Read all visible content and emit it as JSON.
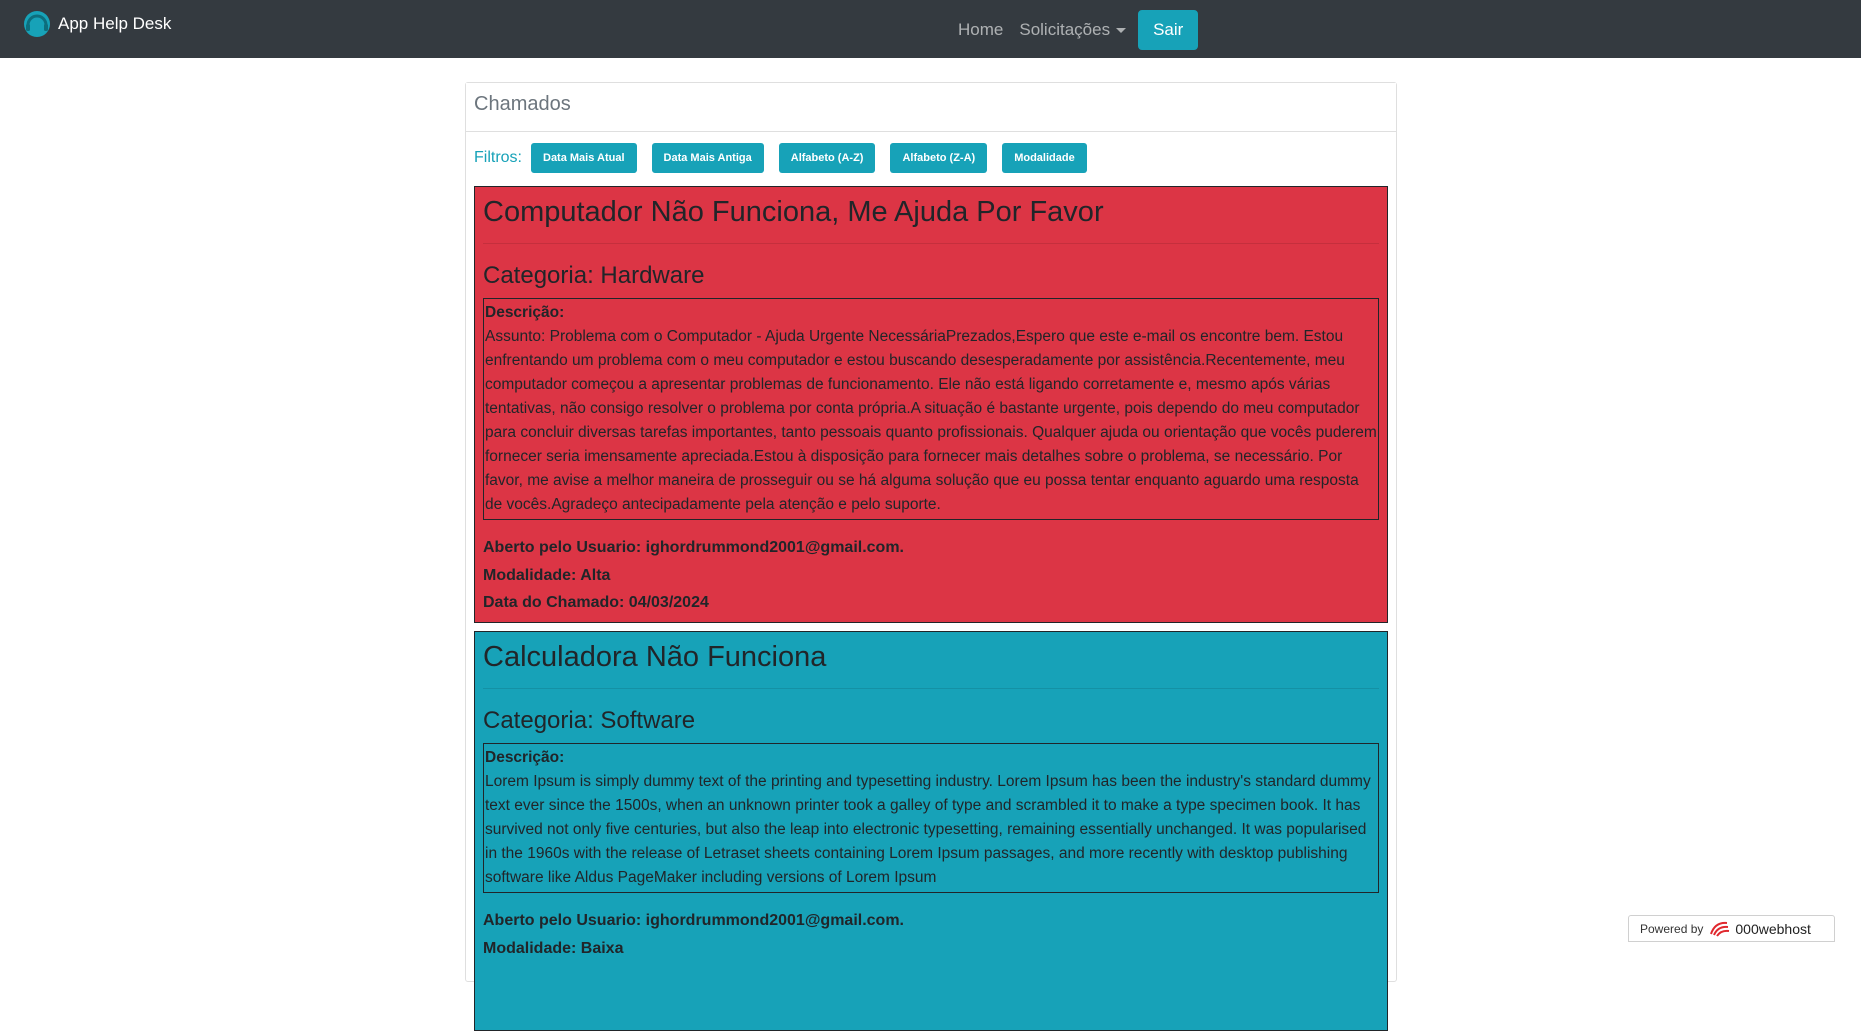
{
  "navbar": {
    "brand": "App Help Desk",
    "home": "Home",
    "solicitacoes": "Solicitações",
    "sair": "Sair"
  },
  "card": {
    "header": "Chamados",
    "filters_label": "Filtros:",
    "filters": [
      "Data Mais Atual",
      "Data Mais Antiga",
      "Alfabeto (A-Z)",
      "Alfabeto (Z-A)",
      "Modalidade"
    ]
  },
  "tickets": [
    {
      "title": "Computador Não Funciona, Me Ajuda Por Favor",
      "categoria": "Categoria: Hardware",
      "descricao_label": "Descrição:",
      "descricao": "Assunto: Problema com o Computador - Ajuda Urgente NecessáriaPrezados,Espero que este e-mail os encontre bem. Estou enfrentando um problema com o meu computador e estou buscando desesperadamente por assistência.Recentemente, meu computador começou a apresentar problemas de funcionamento. Ele não está ligando corretamente e, mesmo após várias tentativas, não consigo resolver o problema por conta própria.A situação é bastante urgente, pois dependo do meu computador para concluir diversas tarefas importantes, tanto pessoais quanto profissionais. Qualquer ajuda ou orientação que vocês puderem fornecer seria imensamente apreciada.Estou à disposição para fornecer mais detalhes sobre o problema, se necessário. Por favor, me avise a melhor maneira de prosseguir ou se há alguma solução que eu possa tentar enquanto aguardo uma resposta de vocês.Agradeço antecipadamente pela atenção e pelo suporte.",
      "aberto": "Aberto pelo Usuario: ighordrummond2001@gmail.com.",
      "modalidade": "Modalidade: Alta",
      "data": "Data do Chamado: 04/03/2024",
      "color": "#dc3545"
    },
    {
      "title": "Calculadora Não Funciona",
      "categoria": "Categoria: Software",
      "descricao_label": "Descrição:",
      "descricao": "Lorem Ipsum is simply dummy text of the printing and typesetting industry. Lorem Ipsum has been the industry's standard dummy text ever since the 1500s, when an unknown printer took a galley of type and scrambled it to make a type specimen book. It has survived not only five centuries, but also the leap into electronic typesetting, remaining essentially unchanged. It was popularised in the 1960s with the release of Letraset sheets containing Lorem Ipsum passages, and more recently with desktop publishing software like Aldus PageMaker including versions of Lorem Ipsum",
      "aberto": "Aberto pelo Usuario: ighordrummond2001@gmail.com.",
      "modalidade": "Modalidade: Baixa",
      "color": "#17a2b8"
    }
  ],
  "powered": {
    "label": "Powered by",
    "host": "000webhost"
  }
}
